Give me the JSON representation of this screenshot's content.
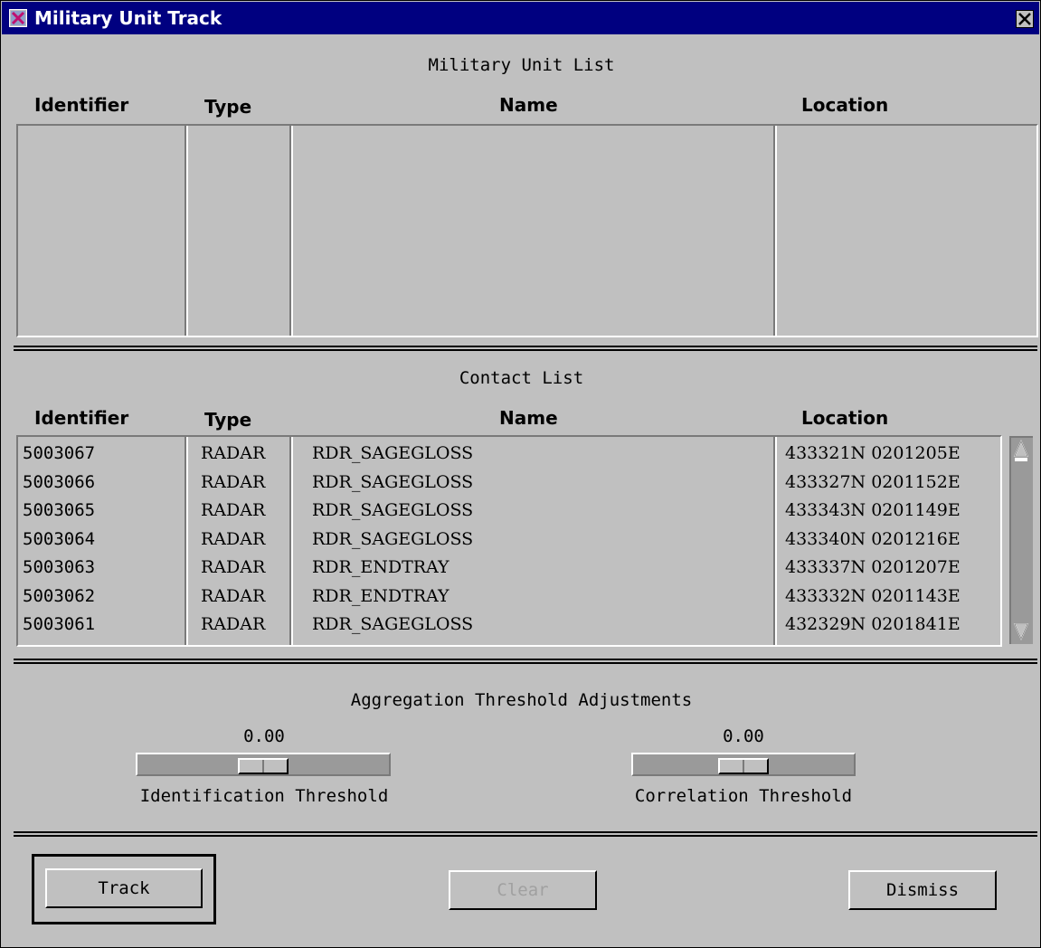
{
  "window": {
    "title": "Military Unit Track"
  },
  "icons": {
    "app": "window-app-icon",
    "close": "close-icon",
    "scroll_up": "scroll-up-arrow-icon",
    "scroll_down": "scroll-down-arrow-icon"
  },
  "unit_list": {
    "title": "Military Unit List",
    "columns": [
      "Identifier",
      "Type",
      "Name",
      "Location"
    ],
    "rows": []
  },
  "contact_list": {
    "title": "Contact List",
    "columns": [
      "Identifier",
      "Type",
      "Name",
      "Location"
    ],
    "rows": [
      {
        "id": "5003067",
        "type": "RADAR",
        "name": "RDR_SAGEGLOSS",
        "location": "433321N 0201205E"
      },
      {
        "id": "5003066",
        "type": "RADAR",
        "name": "RDR_SAGEGLOSS",
        "location": "433327N 0201152E"
      },
      {
        "id": "5003065",
        "type": "RADAR",
        "name": "RDR_SAGEGLOSS",
        "location": "433343N 0201149E"
      },
      {
        "id": "5003064",
        "type": "RADAR",
        "name": "RDR_SAGEGLOSS",
        "location": "433340N 0201216E"
      },
      {
        "id": "5003063",
        "type": "RADAR",
        "name": "RDR_ENDTRAY",
        "location": "433337N 0201207E"
      },
      {
        "id": "5003062",
        "type": "RADAR",
        "name": "RDR_ENDTRAY",
        "location": "433332N 0201143E"
      },
      {
        "id": "5003061",
        "type": "RADAR",
        "name": "RDR_SAGEGLOSS",
        "location": "432329N 0201841E"
      }
    ]
  },
  "aggregation": {
    "title": "Aggregation Threshold Adjustments",
    "identification": {
      "value": "0.00",
      "label": "Identification Threshold",
      "level": 0.5
    },
    "correlation": {
      "value": "0.00",
      "label": "Correlation Threshold",
      "level": 0.5
    }
  },
  "buttons": {
    "track": "Track",
    "clear": "Clear",
    "dismiss": "Dismiss"
  },
  "colors": {
    "titlebar": "#000080",
    "window_bg": "#c0c0c0"
  }
}
